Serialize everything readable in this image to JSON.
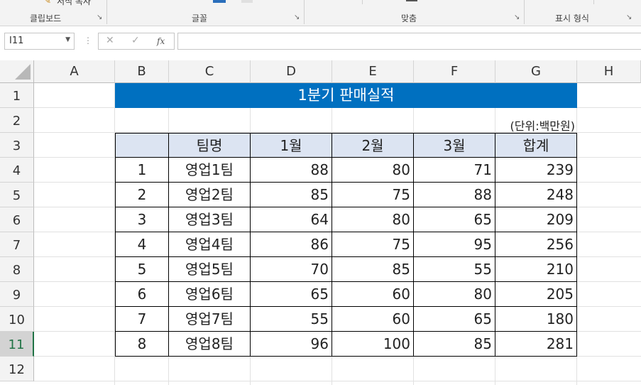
{
  "ribbon": {
    "clipboard_item": "서식 복사",
    "groups": [
      {
        "label": "클립보드"
      },
      {
        "label": "글꼴"
      },
      {
        "label": "맞춤"
      },
      {
        "label": "표시 형식"
      }
    ]
  },
  "formula_bar": {
    "name_box": "I11",
    "cancel_icon": "✕",
    "enter_icon": "✓",
    "fx_label": "fx",
    "formula": ""
  },
  "columns": [
    "A",
    "B",
    "C",
    "D",
    "E",
    "F",
    "G",
    "H"
  ],
  "rows": [
    "1",
    "2",
    "3",
    "4",
    "5",
    "6",
    "7",
    "8",
    "9",
    "10",
    "11",
    "12"
  ],
  "selected_row": "11",
  "sheet": {
    "title": "1분기 판매실적",
    "unit": "(단위:백만원)",
    "headers": [
      "",
      "팀명",
      "1월",
      "2월",
      "3월",
      "합계"
    ],
    "records": [
      [
        "1",
        "영업1팀",
        "88",
        "80",
        "71",
        "239"
      ],
      [
        "2",
        "영업2팀",
        "85",
        "75",
        "88",
        "248"
      ],
      [
        "3",
        "영업3팀",
        "64",
        "80",
        "65",
        "209"
      ],
      [
        "4",
        "영업4팀",
        "86",
        "75",
        "95",
        "256"
      ],
      [
        "5",
        "영업5팀",
        "70",
        "85",
        "55",
        "210"
      ],
      [
        "6",
        "영업6팀",
        "65",
        "60",
        "80",
        "205"
      ],
      [
        "7",
        "영업7팀",
        "55",
        "60",
        "65",
        "180"
      ],
      [
        "8",
        "영업8팀",
        "96",
        "100",
        "85",
        "281"
      ]
    ]
  },
  "colors": {
    "title_fill": "#0070c0",
    "header_fill": "#dce4f2",
    "selection_accent": "#217346"
  }
}
